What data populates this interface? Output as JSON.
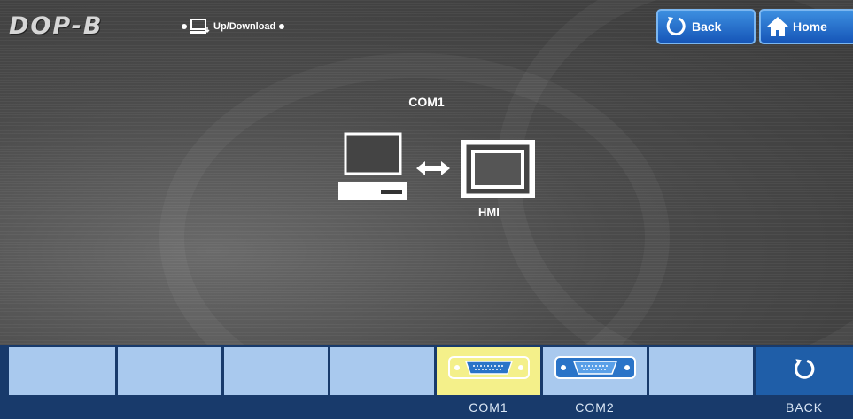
{
  "header": {
    "logo": "DOP-B",
    "mode_label": "Up/Download",
    "back_label": "Back",
    "home_label": "Home"
  },
  "main": {
    "title": "COM1",
    "hmi_label": "HMI"
  },
  "bottom_bar": {
    "buttons": [
      {
        "label": ""
      },
      {
        "label": ""
      },
      {
        "label": ""
      },
      {
        "label": ""
      },
      {
        "label": "COM1",
        "active": true
      },
      {
        "label": "COM2"
      },
      {
        "label": ""
      },
      {
        "label": "BACK"
      }
    ]
  },
  "colors": {
    "header_button": "#1f6fcf",
    "bar_button": "#a9c9ee",
    "bar_active": "#f4f08a",
    "bar_background": "#183a6b"
  }
}
